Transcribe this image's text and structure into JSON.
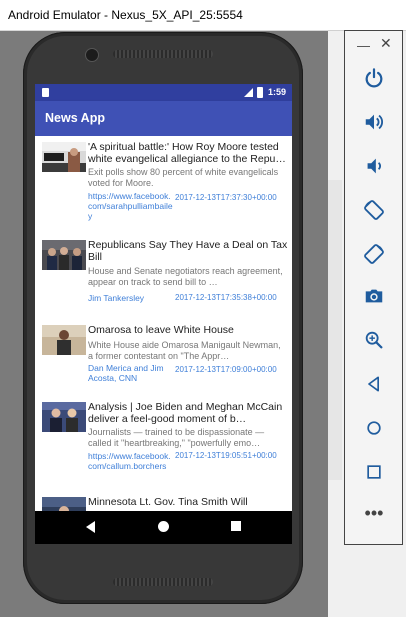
{
  "window": {
    "title": "Android Emulator - Nexus_5X_API_25:5554"
  },
  "status_bar": {
    "time": "1:59"
  },
  "app": {
    "title": "News App"
  },
  "articles": [
    {
      "title": "'A spiritual battle:' How Roy Moore tested white evangelical allegiance to the Repu…",
      "description": "Exit polls show 80 percent of white evangelicals voted for Moore.",
      "author": "https://www.facebook.com/sarahpulliambailey",
      "date": "2017-12-13T17:37:30+00:00",
      "thumb_text": "JUDGE ROY MOORE"
    },
    {
      "title": "Republicans Say They Have a Deal on Tax Bill",
      "description": "House and Senate negotiators reach agreement, appear on track to send bill to …",
      "author": "Jim Tankersley",
      "date": "2017-12-13T17:35:38+00:00",
      "thumb_text": ""
    },
    {
      "title": "Omarosa to leave White House",
      "description": "White House aide Omarosa Manigault Newman, a former contestant on \"The Appr…",
      "author": "Dan Merica and Jim Acosta, CNN",
      "date": "2017-12-13T17:09:00+00:00",
      "thumb_text": ""
    },
    {
      "title": "Analysis | Joe Biden and Meghan McCain deliver a feel-good moment of b…",
      "description": "Journalists — trained to be dispassionate — called it \"heartbreaking,\" \"powerfully emo…",
      "author": "https://www.facebook.com/callum.borchers",
      "date": "2017-12-13T19:05:51+00:00",
      "thumb_text": ""
    },
    {
      "title": "Minnesota Lt. Gov. Tina Smith Will",
      "description": "",
      "author": "",
      "date": "",
      "thumb_text": ""
    }
  ],
  "toolbar": {
    "minimize": "—",
    "close": "✕",
    "more": "•••",
    "buttons": [
      "power-icon",
      "volume-up-icon",
      "volume-down-icon",
      "rotate-left-icon",
      "rotate-right-icon",
      "camera-icon",
      "zoom-icon",
      "back-icon",
      "home-icon",
      "overview-icon"
    ]
  },
  "colors": {
    "status_bar": "#303f9f",
    "app_bar": "#3f51b5",
    "link": "#3f7fd8"
  }
}
